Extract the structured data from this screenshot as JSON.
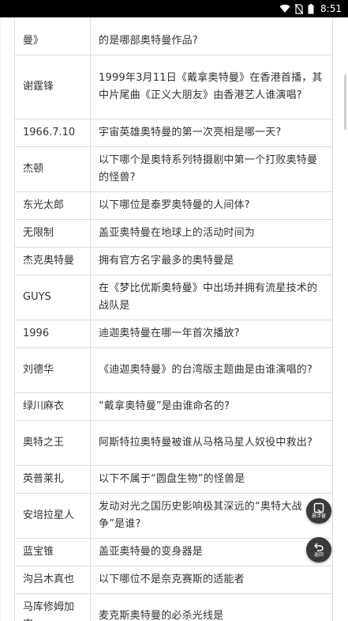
{
  "status_bar": {
    "time": "8:51",
    "icons": [
      "wifi-icon",
      "no-sim-icon",
      "battery-icon"
    ]
  },
  "rows": [
    {
      "answer": "曼》",
      "question": "的是哪部奥特曼作品?"
    },
    {
      "answer": "谢霆锋",
      "question": "1999年3月11日《戴拿奥特曼》在香港首播，其中片尾曲《正义大朋友》由香港艺人谁演唱?"
    },
    {
      "answer": "1966.7.10",
      "question": "宇宙英雄奥特曼的第一次亮相是哪一天?"
    },
    {
      "answer": "杰顿",
      "question": "以下哪个是奥特系列特摄剧中第一个打败奥特曼的怪兽?"
    },
    {
      "answer": "东光太郎",
      "question": "以下哪位是泰罗奥特曼的人间体?"
    },
    {
      "answer": "无限制",
      "question": "盖亚奥特曼在地球上的活动时间为"
    },
    {
      "answer": "杰克奥特曼",
      "question": "拥有官方名字最多的奥特曼是"
    },
    {
      "answer": "GUYS",
      "question": "在《梦比优斯奥特曼》中出场并拥有流星技术的战队是"
    },
    {
      "answer": "1996",
      "question": "迪迦奥特曼在哪一年首次播放?"
    },
    {
      "answer": "刘德华",
      "question": "《迪迦奥特曼》的台湾版主题曲是由谁演唱的?"
    },
    {
      "answer": "绿川麻衣",
      "question": "“戴拿奥特曼”是由谁命名的?"
    },
    {
      "answer": "奥特之王",
      "question": "阿斯特拉奥特曼被谁从马格马星人奴役中救出?"
    },
    {
      "answer": "英普莱扎",
      "question": "以下不属于“圆盘生物”的怪兽是"
    },
    {
      "answer": "安培拉星人",
      "question": "发动对光之国历史影响极其深远的“奥特大战争”是谁?"
    },
    {
      "answer": "蓝宝锥",
      "question": "盖亚奥特曼的变身器是"
    },
    {
      "answer": "沟吕木真也",
      "question": "以下哪位不是奈克赛斯的适能者"
    },
    {
      "answer": "马库修姆加农",
      "question": "麦克斯奥特曼的必杀光线是"
    }
  ],
  "floating_buttons": {
    "float_window_label": "悬浮窗",
    "back_label": "返回"
  }
}
